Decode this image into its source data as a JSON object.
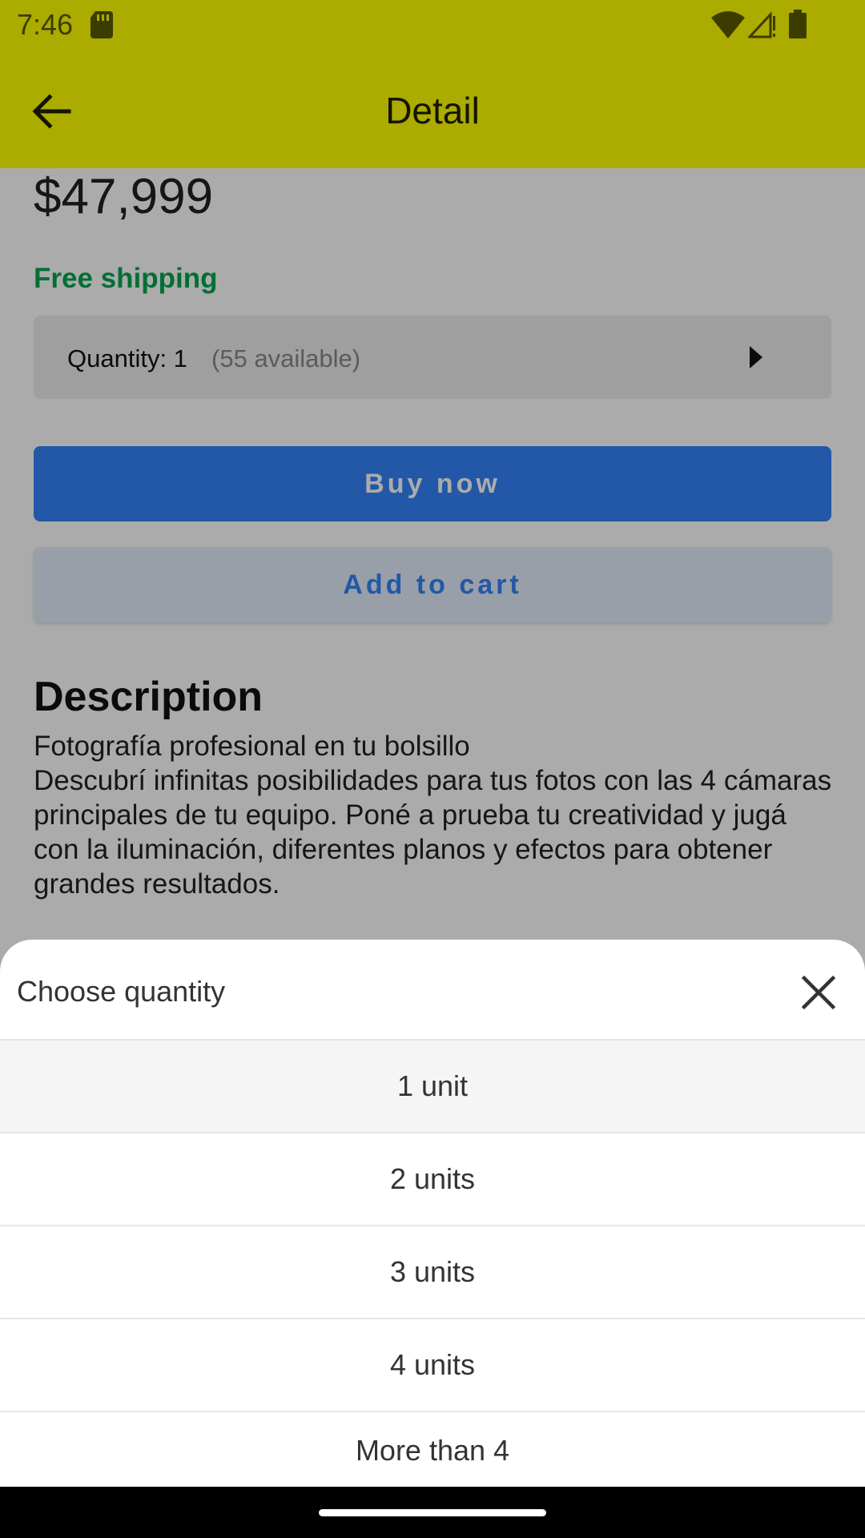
{
  "status_bar": {
    "time": "7:46",
    "icons": [
      "sd-card-icon",
      "wifi-icon",
      "signal-icon",
      "battery-icon"
    ]
  },
  "app_bar": {
    "title": "Detail",
    "back_icon": "back-arrow-icon"
  },
  "product": {
    "price": "$47,999",
    "shipping": "Free shipping",
    "quantity_label": "Quantity: 1",
    "quantity_available": "(55 available)",
    "buy_label": "Buy now",
    "cart_label": "Add to cart",
    "description_title": "Description",
    "description_lines": [
      "Fotografía profesional en tu bolsillo",
      "Descubrí infinitas posibilidades para tus fotos con las 4 cámaras principales de tu equipo. Poné a prueba tu creatividad y jugá con la iluminación, diferentes planos y efectos para obtener grandes resultados."
    ]
  },
  "sheet": {
    "title": "Choose quantity",
    "close_icon": "close-icon",
    "options": [
      "1 unit",
      "2 units",
      "3 units",
      "4 units",
      "More than 4"
    ],
    "selected_index": 0
  },
  "colors": {
    "app_bar": "#ffff00",
    "primary": "#3483fa",
    "shipping": "#00a650"
  }
}
